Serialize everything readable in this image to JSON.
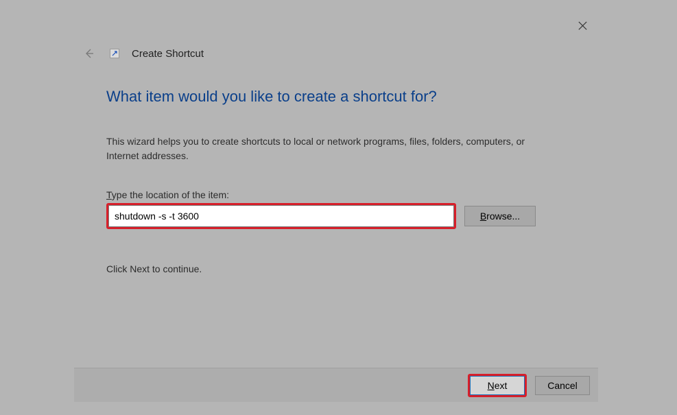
{
  "window": {
    "title": "Create Shortcut"
  },
  "main": {
    "heading": "What item would you like to create a shortcut for?",
    "description": "This wizard helps you to create shortcuts to local or network programs, files, folders, computers, or Internet addresses.",
    "location_label": "Type the location of the item:",
    "location_value": "shutdown -s -t 3600",
    "browse_label": "Browse...",
    "continue_text": "Click Next to continue."
  },
  "footer": {
    "next_label": "Next",
    "cancel_label": "Cancel"
  },
  "highlight_color": "#d71f2a"
}
